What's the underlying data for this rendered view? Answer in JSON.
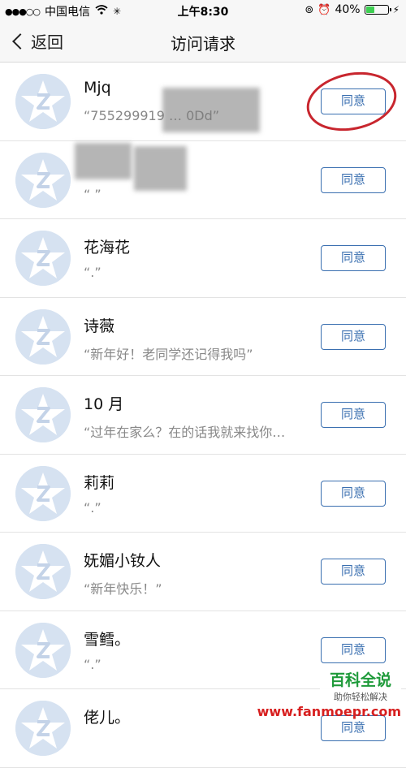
{
  "status_bar": {
    "carrier": "中国电信",
    "time": "上午8:30",
    "battery": "40%",
    "battery_level": 0.4
  },
  "nav": {
    "back_label": "返回",
    "title": "访问请求"
  },
  "requests": [
    {
      "name": "Mjq",
      "message": "“755299919 … 0Dd”",
      "button": "同意"
    },
    {
      "name": "",
      "message": "“ ”",
      "button": "同意"
    },
    {
      "name": "花海花",
      "message": "“.”",
      "button": "同意"
    },
    {
      "name": "诗薇",
      "message": "“新年好！老同学还记得我吗”",
      "button": "同意"
    },
    {
      "name": "10 月",
      "message": "“过年在家么？在的话我就来找你…",
      "button": "同意"
    },
    {
      "name": "莉莉",
      "message": "“.”",
      "button": "同意"
    },
    {
      "name": "妩媚小钕人",
      "message": "“新年快乐！”",
      "button": "同意"
    },
    {
      "name": "雪鳕。",
      "message": "“.”",
      "button": "同意"
    },
    {
      "name": "佬儿。",
      "message": "",
      "button": "同意"
    }
  ],
  "watermark": {
    "title": "百科全说",
    "subtitle": "助你轻松解决",
    "url": "www.fanmoepr.com"
  },
  "colors": {
    "accent": "#3a6fb0",
    "avatar_bg": "#d6e2f1",
    "annotation": "#c8262e"
  }
}
